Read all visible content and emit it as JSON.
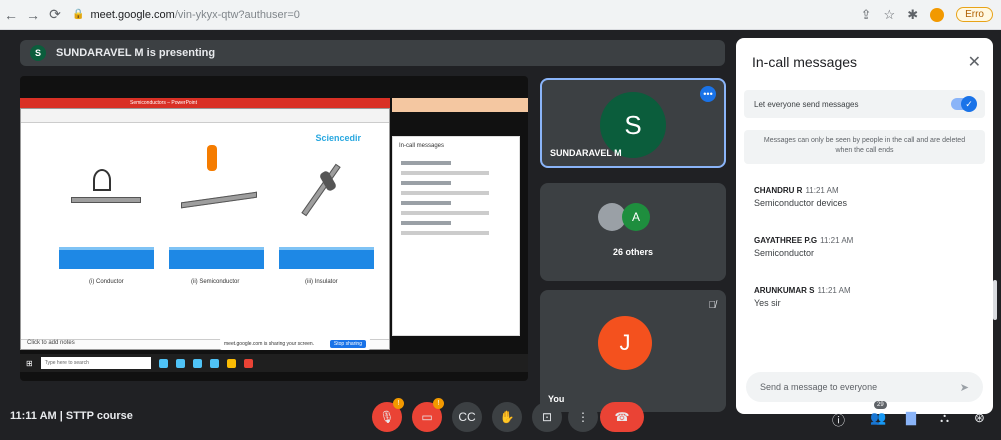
{
  "browser": {
    "url_host": "meet.google.com",
    "url_path": "/vin-ykyx-qtw?authuser=0",
    "error_label": "Erro"
  },
  "presenting": {
    "avatar_letter": "S",
    "text": "SUNDARAVEL M is presenting"
  },
  "shared_screen": {
    "window_title": "Semiconductors – PowerPoint",
    "slide_logo": "Sciencedir",
    "captions": [
      "(i) Conductor",
      "(ii) Semiconductor",
      "(iii) Insulator"
    ],
    "notes_text": "Click to add notes",
    "chat_title": "In-call messages",
    "taskbar_search": "Type here to search",
    "sharing_toast_text": "meet.google.com is sharing your screen.",
    "sharing_toast_button": "Stop sharing"
  },
  "tiles": [
    {
      "avatar": "S",
      "name": "SUNDARAVEL M",
      "color": "#0b5d3c"
    },
    {
      "avatar": "A",
      "name": "26 others",
      "color": "#1e8e3e"
    },
    {
      "avatar": "J",
      "name": "You",
      "color": "#f4511e"
    }
  ],
  "panel": {
    "title": "In-call messages",
    "toggle_label": "Let everyone send messages",
    "toggle_on": true,
    "notice": "Messages can only be seen by people in the call and are deleted when the call ends",
    "messages": [
      {
        "sender": "CHANDRU R",
        "time": "11:21 AM",
        "text": "Semiconductor devices"
      },
      {
        "sender": "GAYATHREE P.G",
        "time": "11:21 AM",
        "text": "Semiconductor"
      },
      {
        "sender": "ARUNKUMAR S",
        "time": "11:21 AM",
        "text": "Yes sir"
      }
    ],
    "input_placeholder": "Send a message to everyone"
  },
  "controls": {
    "meeting_info": "11:11 AM  |  STTP course",
    "warning_badge": "!",
    "people_count": "29"
  }
}
